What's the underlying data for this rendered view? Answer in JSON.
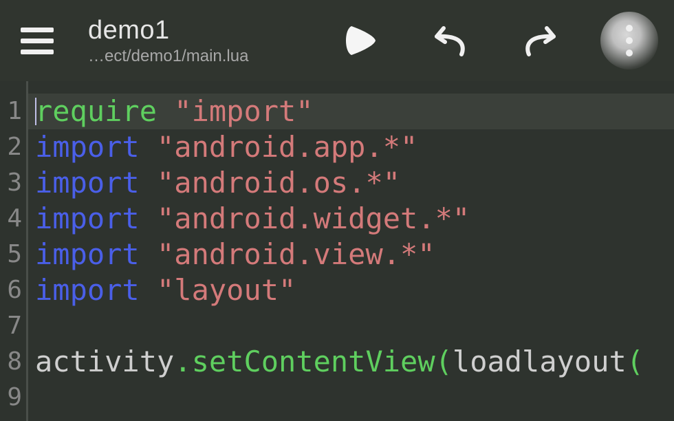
{
  "toolbar": {
    "title": "demo1",
    "subtitle": "…ect/demo1/main.lua",
    "icons": {
      "menu": "menu-icon",
      "play": "play-icon",
      "undo": "undo-icon",
      "redo": "redo-icon",
      "more": "more-icon"
    }
  },
  "editor": {
    "gutter": [
      "1",
      "2",
      "3",
      "4",
      "5",
      "6",
      "7",
      "8",
      "9"
    ],
    "highlighted_line": 1,
    "lines": [
      {
        "tokens": [
          {
            "cls": "tok-kw1",
            "text": "require "
          },
          {
            "cls": "tok-str",
            "text": "\"import\""
          }
        ]
      },
      {
        "tokens": [
          {
            "cls": "tok-kw2",
            "text": "import "
          },
          {
            "cls": "tok-str",
            "text": "\"android.app.*\""
          }
        ]
      },
      {
        "tokens": [
          {
            "cls": "tok-kw2",
            "text": "import "
          },
          {
            "cls": "tok-str",
            "text": "\"android.os.*\""
          }
        ]
      },
      {
        "tokens": [
          {
            "cls": "tok-kw2",
            "text": "import "
          },
          {
            "cls": "tok-str",
            "text": "\"android.widget.*\""
          }
        ]
      },
      {
        "tokens": [
          {
            "cls": "tok-kw2",
            "text": "import "
          },
          {
            "cls": "tok-str",
            "text": "\"android.view.*\""
          }
        ]
      },
      {
        "tokens": [
          {
            "cls": "tok-kw2",
            "text": "import "
          },
          {
            "cls": "tok-str",
            "text": "\"layout\""
          }
        ]
      },
      {
        "tokens": []
      },
      {
        "tokens": [
          {
            "cls": "tok-ident",
            "text": "activity"
          },
          {
            "cls": "tok-punc",
            "text": "."
          },
          {
            "cls": "tok-func",
            "text": "setContentView"
          },
          {
            "cls": "tok-punc",
            "text": "("
          },
          {
            "cls": "tok-ident",
            "text": "loadlayout"
          },
          {
            "cls": "tok-punc",
            "text": "("
          }
        ]
      },
      {
        "tokens": []
      }
    ]
  },
  "colors": {
    "bg": "#2e332e",
    "toolbar": "#30352f",
    "keyword_require": "#5fcf5f",
    "keyword_import": "#4a5fe8",
    "string": "#d47a7a",
    "ident": "#cfcfcf"
  }
}
